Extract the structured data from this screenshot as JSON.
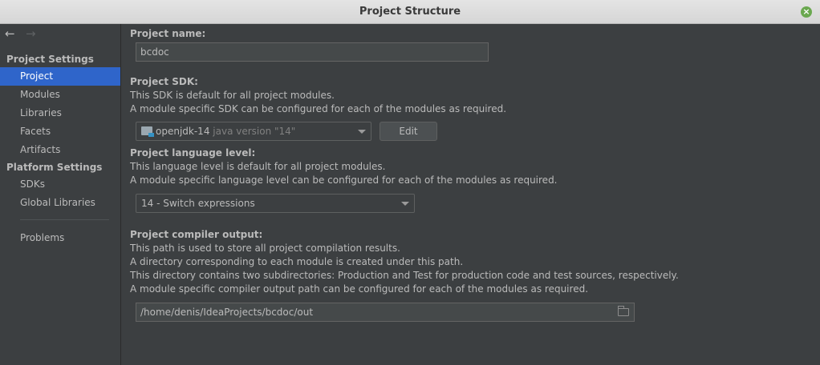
{
  "window": {
    "title": "Project Structure"
  },
  "nav": {
    "back_icon": "←",
    "forward_icon": "→"
  },
  "sidebar": {
    "section1": "Project Settings",
    "items1": [
      "Project",
      "Modules",
      "Libraries",
      "Facets",
      "Artifacts"
    ],
    "section2": "Platform Settings",
    "items2": [
      "SDKs",
      "Global Libraries"
    ],
    "items3": [
      "Problems"
    ],
    "selected": "Project"
  },
  "project_name": {
    "label": "Project name:",
    "value": "bcdoc"
  },
  "sdk": {
    "label": "Project SDK:",
    "desc1": "This SDK is default for all project modules.",
    "desc2": "A module specific SDK can be configured for each of the modules as required.",
    "selected_name": "openjdk-14",
    "selected_version": "java version \"14\"",
    "edit_label": "Edit"
  },
  "language": {
    "label": "Project language level:",
    "desc1": "This language level is default for all project modules.",
    "desc2": "A module specific language level can be configured for each of the modules as required.",
    "selected": "14 - Switch expressions"
  },
  "compiler": {
    "label": "Project compiler output:",
    "desc1": "This path is used to store all project compilation results.",
    "desc2": "A directory corresponding to each module is created under this path.",
    "desc3": "This directory contains two subdirectories: Production and Test for production code and test sources, respectively.",
    "desc4": "A module specific compiler output path can be configured for each of the modules as required.",
    "path": "/home/denis/IdeaProjects/bcdoc/out"
  }
}
